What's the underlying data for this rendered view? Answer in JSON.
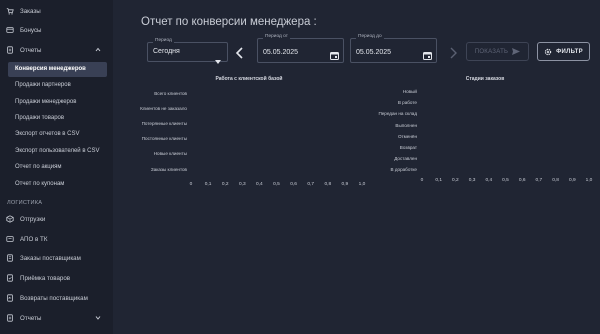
{
  "sidebar": {
    "items_top": [
      {
        "label": "Заказы",
        "icon": "cart-icon"
      },
      {
        "label": "Бонусы",
        "icon": "bonus-icon"
      },
      {
        "label": "Отчеты",
        "icon": "report-icon"
      }
    ],
    "reports_sub": [
      "Конверсия менеджеров",
      "Продажи партнеров",
      "Продажи менеджеров",
      "Продажи товаров",
      "Экспорт отчетов в CSV",
      "Экспорт пользователей в CSV",
      "Отчет по акциям",
      "Отчет по купонам"
    ],
    "section_logistics": "ЛОГИСТИКА",
    "logistics_items": [
      {
        "label": "Отгрузки",
        "icon": "shipment-icon"
      },
      {
        "label": "АПО в ТК",
        "icon": "truck-icon"
      },
      {
        "label": "Заказы поставщикам",
        "icon": "supplier-order-icon"
      },
      {
        "label": "Приёмка товаров",
        "icon": "receive-icon"
      },
      {
        "label": "Возвраты поставщикам",
        "icon": "return-icon"
      },
      {
        "label": "Отчеты",
        "icon": "report-icon"
      }
    ]
  },
  "main": {
    "title": "Отчет по конверсии менеджера :",
    "period": {
      "label": "Период",
      "value": "Сегодня"
    },
    "period_from": {
      "label": "Период от",
      "value": "05.05.2025"
    },
    "period_to": {
      "label": "Период до",
      "value": "05.05.2025"
    },
    "show_button": "ПОКАЗАТЬ",
    "filter_button": "ФИЛЬТР"
  },
  "chart_data": [
    {
      "type": "bar",
      "title": "Работа с клиентской базой",
      "orientation": "horizontal",
      "categories": [
        "Всего клиентов",
        "Клиентов не заказало",
        "Потерянные клиенты",
        "Постоянные клиенты",
        "Новые клиенты",
        "Заказы клиентов"
      ],
      "values": [
        0,
        0,
        0,
        0,
        0,
        0
      ],
      "xlim": [
        0,
        1.0
      ],
      "xticks": [
        "0",
        "0,1",
        "0,2",
        "0,3",
        "0,4",
        "0,5",
        "0,6",
        "0,7",
        "0,8",
        "0,9",
        "1,0"
      ]
    },
    {
      "type": "bar",
      "title": "Стадии заказов",
      "orientation": "horizontal",
      "categories": [
        "Новый",
        "В работе",
        "Передан на склад",
        "Выполнен",
        "Отменён",
        "Возврат",
        "Доставлен",
        "В доработке"
      ],
      "values": [
        0,
        0,
        0,
        0,
        0,
        0,
        0,
        0
      ],
      "xlim": [
        0,
        1.0
      ],
      "xticks": [
        "0",
        "0,1",
        "0,2",
        "0,3",
        "0,4",
        "0,5",
        "0,6",
        "0,7",
        "0,8",
        "0,9",
        "1,0"
      ]
    }
  ],
  "colors": {
    "background": "#202533",
    "sidebar": "#1b1f2b",
    "active_item": "#394055",
    "accent": "#e3e6ec"
  }
}
